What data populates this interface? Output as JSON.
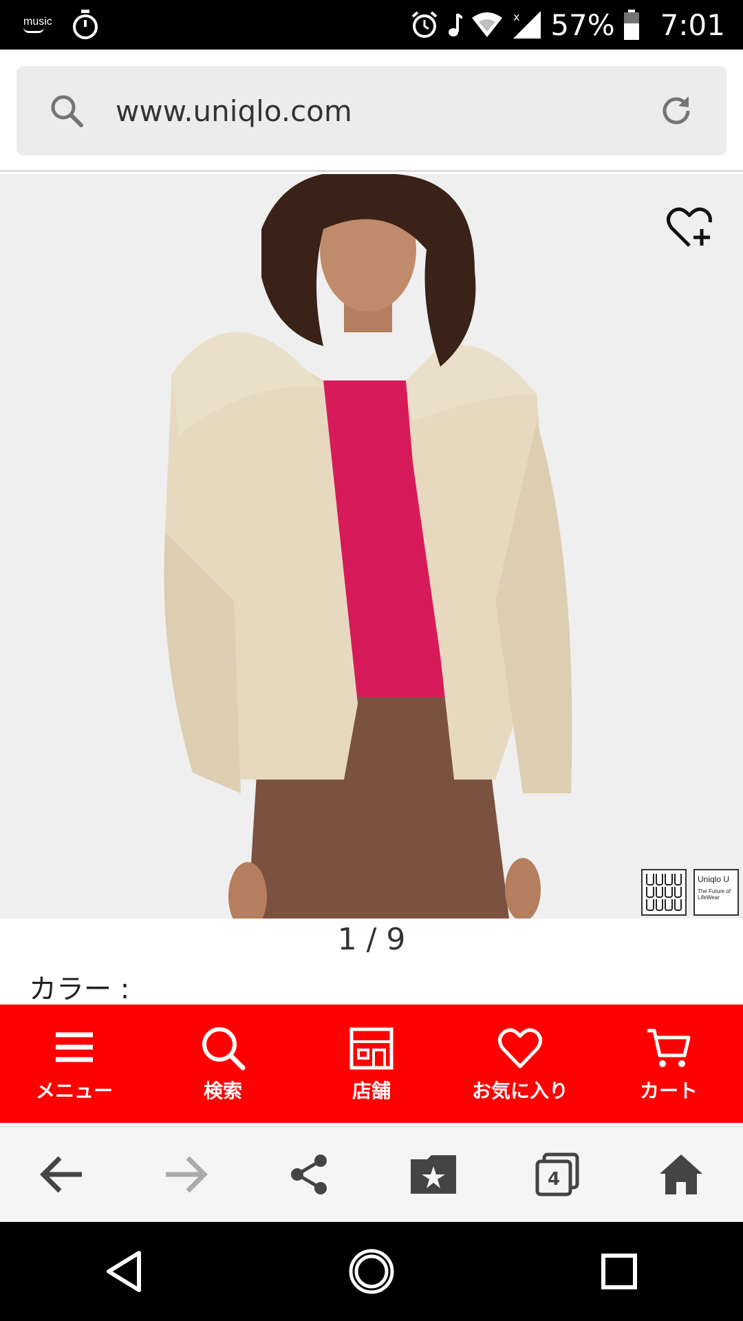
{
  "status_bar": {
    "music_label": "music",
    "battery_percent": "57%",
    "time": "7:01"
  },
  "url_bar": {
    "url": "www.uniqlo.com"
  },
  "product": {
    "pager": "1 / 9",
    "color_label": "カラー :",
    "badge_brand": "Uniqlo U",
    "badge_tagline": "The Future of LifeWear"
  },
  "site_nav": {
    "items": [
      {
        "label": "メニュー",
        "icon": "menu-icon"
      },
      {
        "label": "検索",
        "icon": "search-icon"
      },
      {
        "label": "店舗",
        "icon": "store-icon"
      },
      {
        "label": "お気に入り",
        "icon": "heart-icon"
      },
      {
        "label": "カート",
        "icon": "cart-icon"
      }
    ],
    "background": "#ff0000"
  },
  "browser_toolbar": {
    "tab_count": "4"
  }
}
